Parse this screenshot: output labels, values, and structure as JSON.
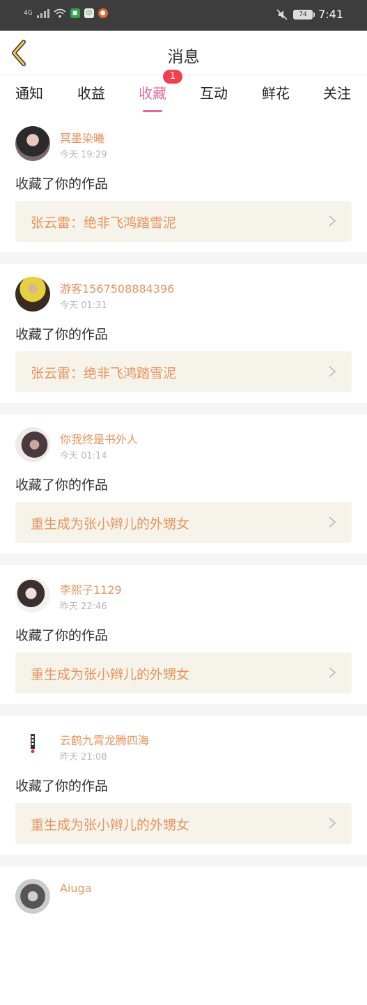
{
  "status_bar": {
    "network": "4G",
    "battery": "74",
    "time": "7:41"
  },
  "header": {
    "title": "消息"
  },
  "tabs": [
    {
      "label": "通知"
    },
    {
      "label": "收益"
    },
    {
      "label": "收藏",
      "active": true,
      "badge": "1"
    },
    {
      "label": "互动"
    },
    {
      "label": "鲜花"
    },
    {
      "label": "关注"
    }
  ],
  "feed": [
    {
      "user": "冥墨染曦",
      "time": "今天 19:29",
      "action": "收藏了你的作品",
      "work": "张云雷：绝非飞鸿踏雪泥"
    },
    {
      "user": "游客1567508884396",
      "time": "今天 01:31",
      "action": "收藏了你的作品",
      "work": "张云雷：绝非飞鸿踏雪泥"
    },
    {
      "user": "你我终是书外人",
      "time": "今天 01:14",
      "action": "收藏了你的作品",
      "work": "重生成为张小辫儿的外甥女"
    },
    {
      "user": "李熙子1129",
      "time": "昨天 22:46",
      "action": "收藏了你的作品",
      "work": "重生成为张小辫儿的外甥女"
    },
    {
      "user": "云鹤九霄龙腾四海",
      "time": "昨天 21:08",
      "action": "收藏了你的作品",
      "work": "重生成为张小辫儿的外甥女"
    },
    {
      "user": "Aiuga"
    }
  ],
  "colors": {
    "accent": "#e06b9c",
    "name": "#e7935f",
    "badge": "#f0404f",
    "card_bg": "#f6f4ea"
  }
}
